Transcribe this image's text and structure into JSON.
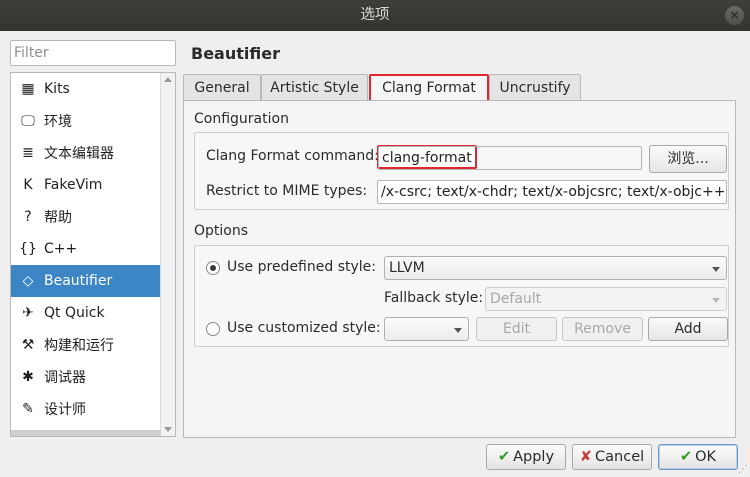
{
  "window": {
    "title": "选项",
    "close_glyph": "×"
  },
  "filter": {
    "placeholder": "Filter"
  },
  "sidebar": {
    "items": [
      {
        "label": "Kits",
        "icon": "kits-icon",
        "glyph": "▦"
      },
      {
        "label": "环境",
        "icon": "monitor-icon",
        "glyph": "🖵"
      },
      {
        "label": "文本编辑器",
        "icon": "text-editor-icon",
        "glyph": "≣"
      },
      {
        "label": "FakeVim",
        "icon": "fakevim-icon",
        "glyph": "K"
      },
      {
        "label": "帮助",
        "icon": "help-icon",
        "glyph": "?"
      },
      {
        "label": "C++",
        "icon": "braces-icon",
        "glyph": "{}"
      },
      {
        "label": "Beautifier",
        "icon": "diamond-icon",
        "glyph": "◇",
        "selected": true
      },
      {
        "label": "Qt Quick",
        "icon": "qt-quick-icon",
        "glyph": "✈"
      },
      {
        "label": "构建和运行",
        "icon": "hammer-icon",
        "glyph": "⚒"
      },
      {
        "label": "调试器",
        "icon": "bug-icon",
        "glyph": "✱"
      },
      {
        "label": "设计师",
        "icon": "pencil-icon",
        "glyph": "✎"
      }
    ]
  },
  "main": {
    "title": "Beautifier",
    "tabs": [
      {
        "label": "General"
      },
      {
        "label": "Artistic Style"
      },
      {
        "label": "Clang Format",
        "active": true
      },
      {
        "label": "Uncrustify"
      }
    ],
    "configuration": {
      "title": "Configuration",
      "command_label": "Clang Format command:",
      "command_value": "clang-format",
      "browse_label": "浏览...",
      "mime_label": "Restrict to MIME types:",
      "mime_value": "/x-csrc; text/x-chdr; text/x-objcsrc; text/x-objc++src"
    },
    "options": {
      "title": "Options",
      "predefined_label": "Use predefined style:",
      "predefined_value": "LLVM",
      "fallback_label": "Fallback style:",
      "fallback_value": "Default",
      "customized_label": "Use customized style:",
      "edit_label": "Edit",
      "remove_label": "Remove",
      "add_label": "Add"
    }
  },
  "buttons": {
    "apply": "Apply",
    "cancel": "Cancel",
    "ok": "OK"
  },
  "colors": {
    "selection": "#3d86c6",
    "highlight_border": "#e0262e"
  }
}
